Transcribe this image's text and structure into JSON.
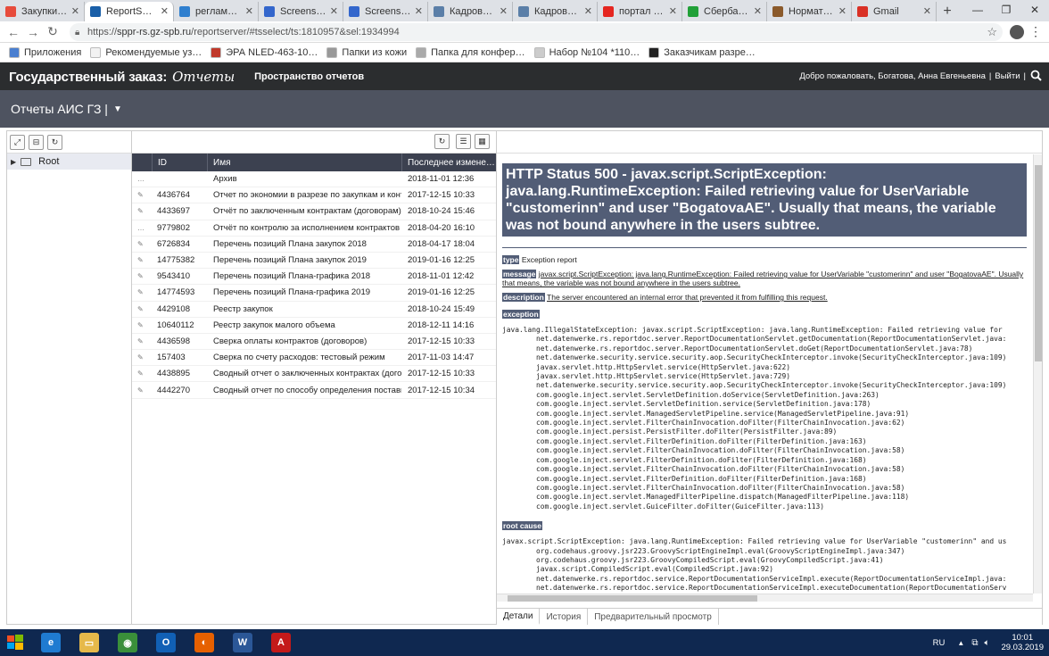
{
  "browser": {
    "tabs": [
      {
        "label": "Закупки :: От…",
        "icon_color": "#e74c3c",
        "active": false
      },
      {
        "label": "ReportServer",
        "icon_color": "#1a5fa8",
        "active": true
      },
      {
        "label": "регламентн…",
        "icon_color": "#2f7fcf",
        "active": false
      },
      {
        "label": "Screenshot -",
        "icon_color": "#3366cc",
        "active": false
      },
      {
        "label": "Screenshot -",
        "icon_color": "#3366cc",
        "active": false
      },
      {
        "label": "Кадровый п…",
        "icon_color": "#5b7fa8",
        "active": false
      },
      {
        "label": "Кадровый п…",
        "icon_color": "#5b7fa8",
        "active": false
      },
      {
        "label": "портал прое…",
        "icon_color": "#e52620",
        "active": false
      },
      {
        "label": "Сбербанк О…",
        "icon_color": "#21a038",
        "active": false
      },
      {
        "label": "Нормативн…",
        "icon_color": "#8b5a2b",
        "active": false
      },
      {
        "label": "Gmail",
        "icon_color": "#d93025",
        "active": false
      }
    ],
    "new_tab": "+",
    "window_controls": [
      "—",
      "❐",
      "✕"
    ],
    "url_prefix": "https://",
    "url_host": "sppr-rs.gz-spb.ru",
    "url_path": "/reportserver/#tsselect/ts:1810957&sel:1934994",
    "bookmarks": [
      {
        "label": "Приложения",
        "icon_color": "#4a7fd0"
      },
      {
        "label": "Рекомендуемые уз…",
        "icon_color": "#f2f2f2"
      },
      {
        "label": "ЭРА NLED-463-10…",
        "icon_color": "#c0392b"
      },
      {
        "label": "Папки из кожи",
        "icon_color": "#999999"
      },
      {
        "label": "Папка для конфер…",
        "icon_color": "#aaaaaa"
      },
      {
        "label": "Набор №104 *110…",
        "icon_color": "#cccccc"
      },
      {
        "label": "Заказчикам разре…",
        "icon_color": "#222222"
      }
    ]
  },
  "app": {
    "brand": "Государственный заказ:",
    "brand_sub": "Отчеты",
    "section": "Пространство отчетов",
    "user_greeting": "Добро пожаловать, Богатова, Анна Евгеньевна",
    "logout": "Выйти",
    "folder_title": "Отчеты АИС ГЗ |"
  },
  "tree": {
    "root_label": "Root"
  },
  "list": {
    "columns": [
      "ID",
      "Имя",
      "Последнее измене…"
    ],
    "rows": [
      {
        "icon": "…",
        "id": "",
        "name": "Архив",
        "date": "2018-11-01 12:36"
      },
      {
        "icon": "✎",
        "id": "4436764",
        "name": "Отчет по экономии в разрезе по закупкам и контр…",
        "date": "2017-12-15 10:33"
      },
      {
        "icon": "✎",
        "id": "4433697",
        "name": "Отчёт по заключенным контрактам (договорам)",
        "date": "2018-10-24 15:46"
      },
      {
        "icon": "…",
        "id": "9779802",
        "name": "Отчёт по контролю за исполнением контрактов (д…",
        "date": "2018-04-20 16:10"
      },
      {
        "icon": "✎",
        "id": "6726834",
        "name": "Перечень позиций Плана закупок 2018",
        "date": "2018-04-17 18:04"
      },
      {
        "icon": "✎",
        "id": "14775382",
        "name": "Перечень позиций Плана закупок 2019",
        "date": "2019-01-16 12:25"
      },
      {
        "icon": "✎",
        "id": "9543410",
        "name": "Перечень позиций Плана-графика 2018",
        "date": "2018-11-01 12:42"
      },
      {
        "icon": "✎",
        "id": "14774593",
        "name": "Перечень позиций Плана-графика 2019",
        "date": "2019-01-16 12:25"
      },
      {
        "icon": "✎",
        "id": "4429108",
        "name": "Реестр закупок",
        "date": "2018-10-24 15:49"
      },
      {
        "icon": "✎",
        "id": "10640112",
        "name": "Реестр закупок малого объема",
        "date": "2018-12-11 14:16"
      },
      {
        "icon": "✎",
        "id": "4436598",
        "name": "Сверка оплаты контрактов (договоров)",
        "date": "2017-12-15 10:33"
      },
      {
        "icon": "✎",
        "id": "157403",
        "name": "Сверка по счету расходов: тестовый режим",
        "date": "2017-11-03 14:47"
      },
      {
        "icon": "✎",
        "id": "4438895",
        "name": "Сводный отчет о заключенных контрактах (догов…",
        "date": "2017-12-15 10:33"
      },
      {
        "icon": "✎",
        "id": "4442270",
        "name": "Сводный отчет по способу определения поставщ…",
        "date": "2017-12-15 10:34"
      }
    ]
  },
  "error": {
    "title": "HTTP Status 500 - javax.script.ScriptException: java.lang.RuntimeException: Failed retrieving value for UserVariable \"customerinn\" and user \"BogatovaAE\". Usually that means, the variable was not bound anywhere in the users subtree.",
    "type_label": "type",
    "type_value": "Exception report",
    "message_label": "message",
    "message_value": "javax.script.ScriptException: java.lang.RuntimeException: Failed retrieving value for UserVariable \"customerinn\" and user \"BogatovaAE\". Usually that means, the variable was not bound anywhere in the users subtree.",
    "description_label": "description",
    "description_value": "The server encountered an internal error that prevented it from fulfilling this request.",
    "exception_label": "exception",
    "exception_trace": "java.lang.IllegalStateException: javax.script.ScriptException: java.lang.RuntimeException: Failed retrieving value for\n\tnet.datenwerke.rs.reportdoc.server.ReportDocumentationServlet.getDocumentation(ReportDocumentationServlet.java:\n\tnet.datenwerke.rs.reportdoc.server.ReportDocumentationServlet.doGet(ReportDocumentationServlet.java:78)\n\tnet.datenwerke.security.service.security.aop.SecurityCheckInterceptor.invoke(SecurityCheckInterceptor.java:109)\n\tjavax.servlet.http.HttpServlet.service(HttpServlet.java:622)\n\tjavax.servlet.http.HttpServlet.service(HttpServlet.java:729)\n\tnet.datenwerke.security.service.security.aop.SecurityCheckInterceptor.invoke(SecurityCheckInterceptor.java:109)\n\tcom.google.inject.servlet.ServletDefinition.doService(ServletDefinition.java:263)\n\tcom.google.inject.servlet.ServletDefinition.service(ServletDefinition.java:178)\n\tcom.google.inject.servlet.ManagedServletPipeline.service(ManagedServletPipeline.java:91)\n\tcom.google.inject.servlet.FilterChainInvocation.doFilter(FilterChainInvocation.java:62)\n\tcom.google.inject.persist.PersistFilter.doFilter(PersistFilter.java:89)\n\tcom.google.inject.servlet.FilterDefinition.doFilter(FilterDefinition.java:163)\n\tcom.google.inject.servlet.FilterChainInvocation.doFilter(FilterChainInvocation.java:58)\n\tcom.google.inject.servlet.FilterDefinition.doFilter(FilterDefinition.java:168)\n\tcom.google.inject.servlet.FilterChainInvocation.doFilter(FilterChainInvocation.java:58)\n\tcom.google.inject.servlet.FilterDefinition.doFilter(FilterDefinition.java:168)\n\tcom.google.inject.servlet.FilterChainInvocation.doFilter(FilterChainInvocation.java:58)\n\tcom.google.inject.servlet.ManagedFilterPipeline.dispatch(ManagedFilterPipeline.java:118)\n\tcom.google.inject.servlet.GuiceFilter.doFilter(GuiceFilter.java:113)",
    "root_cause_label": "root cause",
    "root_cause_trace": "javax.script.ScriptException: java.lang.RuntimeException: Failed retrieving value for UserVariable \"customerinn\" and us\n\torg.codehaus.groovy.jsr223.GroovyScriptEngineImpl.eval(GroovyScriptEngineImpl.java:347)\n\torg.codehaus.groovy.jsr223.GroovyCompiledScript.eval(GroovyCompiledScript.java:41)\n\tjavax.script.CompiledScript.eval(CompiledScript.java:92)\n\tnet.datenwerke.rs.reportdoc.service.ReportDocumentationServiceImpl.execute(ReportDocumentationServiceImpl.java:\n\tnet.datenwerke.rs.reportdoc.service.ReportDocumentationServiceImpl.executeDocumentation(ReportDocumentationServ"
  },
  "detail_tabs": [
    "Детали",
    "История",
    "Предварительный просмотр"
  ],
  "taskbar": {
    "apps": [
      {
        "name": "ie",
        "color": "#1f7bd1",
        "glyph": "e"
      },
      {
        "name": "explorer",
        "color": "#e6b94a",
        "glyph": "▭"
      },
      {
        "name": "chrome",
        "color": "#3a8f3a",
        "glyph": "◉"
      },
      {
        "name": "outlook",
        "color": "#1160b5",
        "glyph": "O"
      },
      {
        "name": "firefox",
        "color": "#e66000",
        "glyph": "◐"
      },
      {
        "name": "word",
        "color": "#2b5797",
        "glyph": "W"
      },
      {
        "name": "acrobat",
        "color": "#c41a1a",
        "glyph": "A"
      }
    ],
    "lang": "RU",
    "time": "10:01",
    "date": "29.03.2019"
  }
}
